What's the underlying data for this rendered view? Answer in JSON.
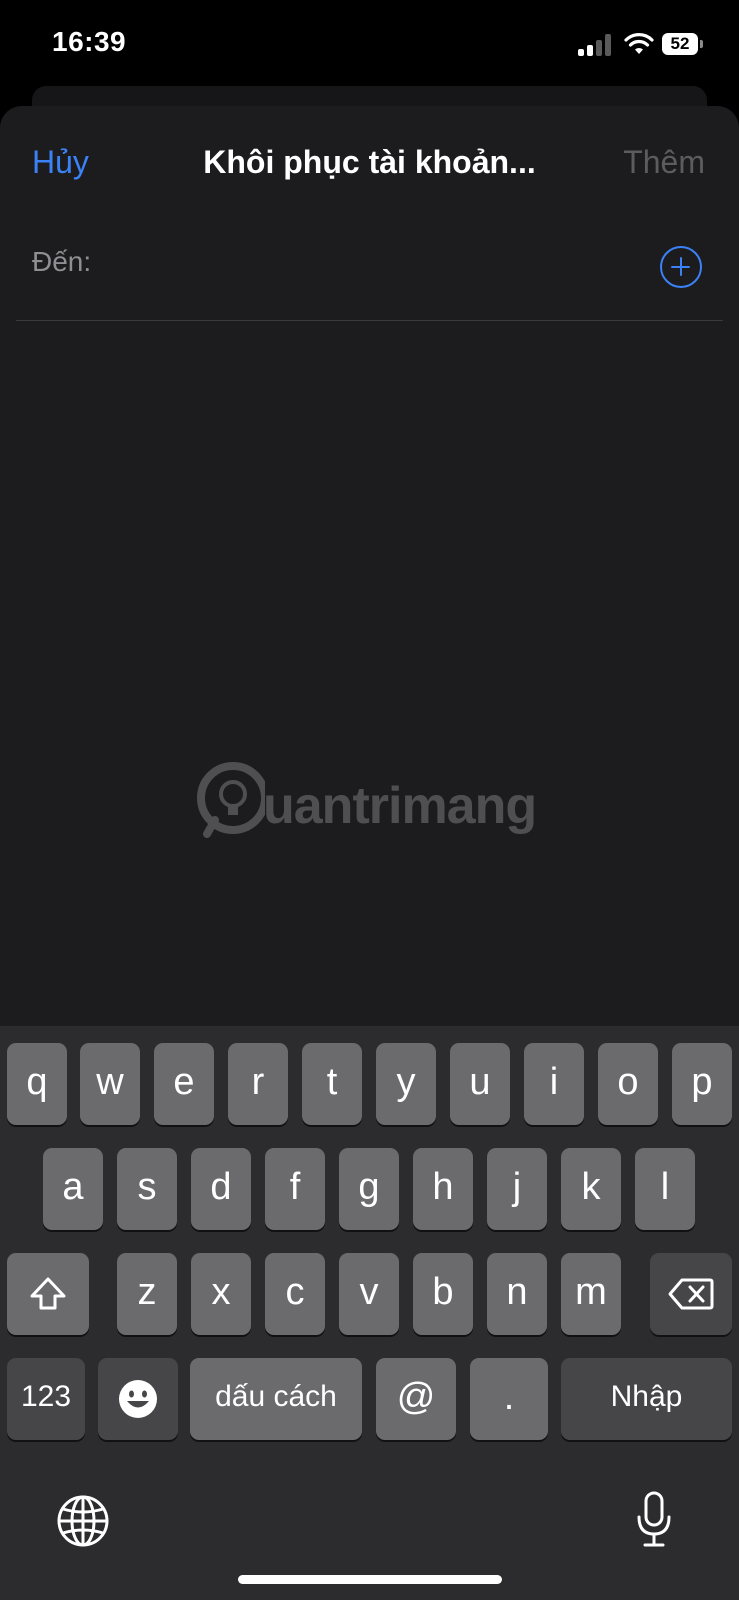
{
  "status_bar": {
    "time": "16:39",
    "battery": "52"
  },
  "nav": {
    "cancel_label": "Hủy",
    "title": "Khôi phục tài khoản...",
    "add_label": "Thêm"
  },
  "recipient": {
    "label": "Đến:",
    "value": ""
  },
  "watermark": {
    "text": "uantrimang"
  },
  "keyboard": {
    "row1": [
      "q",
      "w",
      "e",
      "r",
      "t",
      "y",
      "u",
      "i",
      "o",
      "p"
    ],
    "row2": [
      "a",
      "s",
      "d",
      "f",
      "g",
      "h",
      "j",
      "k",
      "l"
    ],
    "row3": [
      "z",
      "x",
      "c",
      "v",
      "b",
      "n",
      "m"
    ],
    "numbers_label": "123",
    "space_label": "dấu cách",
    "at_label": "@",
    "period_label": ".",
    "return_label": "Nhập"
  },
  "colors": {
    "accent": "#3b82f6",
    "sheet_bg": "#1c1c1e",
    "keyboard_bg": "#2c2c2e",
    "key_bg": "#6b6b6e"
  },
  "icons": [
    "signal-icon",
    "wifi-icon",
    "battery-icon",
    "plus-icon",
    "shift-icon",
    "backspace-icon",
    "emoji-icon",
    "globe-icon",
    "microphone-icon"
  ]
}
